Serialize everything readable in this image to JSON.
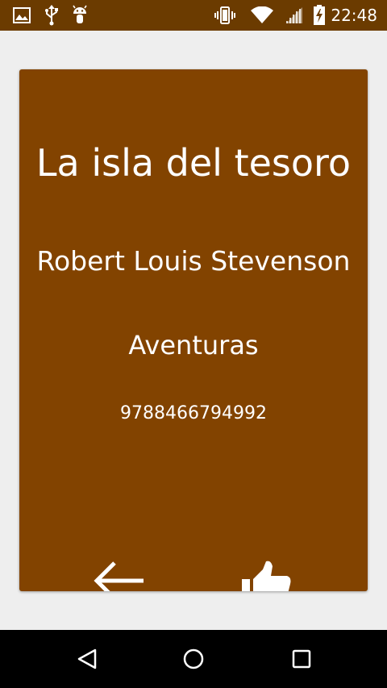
{
  "status_bar": {
    "time": "22:48",
    "left_icons": [
      "image-icon",
      "usb-icon",
      "android-debug-icon"
    ],
    "right_icons": [
      "vibrate-icon",
      "wifi-icon",
      "signal-icon",
      "battery-charging-icon"
    ]
  },
  "book": {
    "title": "La isla del tesoro",
    "author": "Robert Louis Stevenson",
    "genre": "Aventuras",
    "isbn": "9788466794992"
  },
  "card_actions": {
    "back_icon": "arrow-left-icon",
    "like_icon": "thumbs-up-icon"
  },
  "nav_bar": {
    "buttons": [
      "back-triangle-icon",
      "home-circle-icon",
      "recents-square-icon"
    ]
  },
  "colors": {
    "status_bar": "#6b3b00",
    "card": "#824300",
    "background": "#eeeeee",
    "nav_bar": "#000000"
  }
}
